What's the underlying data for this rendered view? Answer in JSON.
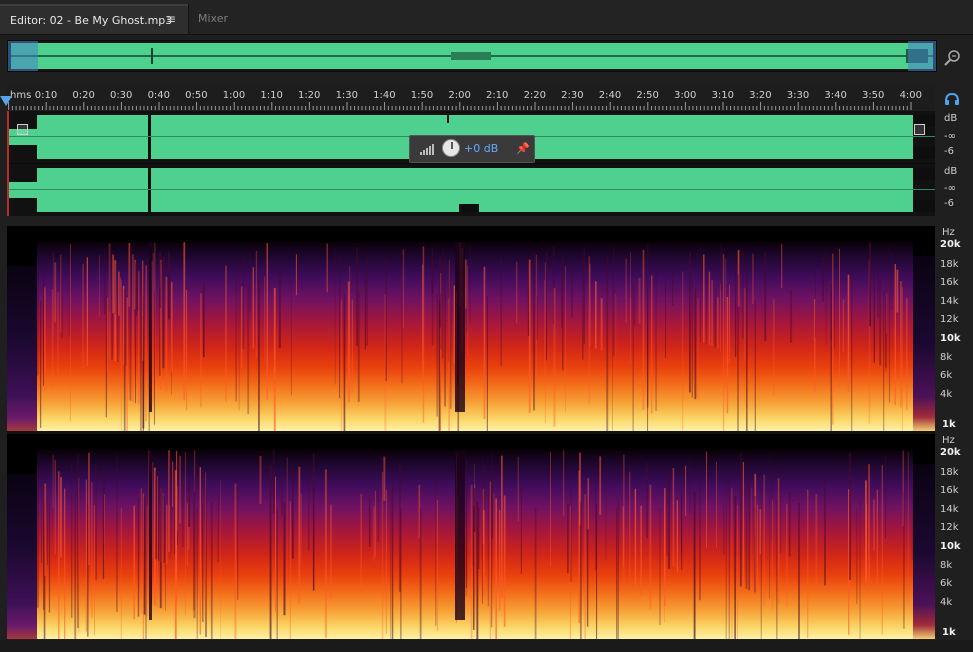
{
  "tabs": {
    "editor_label": "Editor: 02 - Be My Ghost.mp3",
    "mixer_label": "Mixer"
  },
  "ruler": {
    "unit": "hms",
    "ticks": [
      "0:10",
      "0:20",
      "0:30",
      "0:40",
      "0:50",
      "1:00",
      "1:10",
      "1:20",
      "1:30",
      "1:40",
      "1:50",
      "2:00",
      "2:10",
      "2:20",
      "2:30",
      "2:40",
      "2:50",
      "3:00",
      "3:10",
      "3:20",
      "3:30",
      "3:40",
      "3:50",
      "4:00"
    ]
  },
  "hud": {
    "value": "+0 dB"
  },
  "db_scale": {
    "unit": "dB",
    "labels": [
      "-∞",
      "-6"
    ]
  },
  "hz_scale": {
    "unit": "Hz",
    "labels": [
      "20k",
      "18k",
      "16k",
      "14k",
      "12k",
      "10k",
      "8k",
      "6k",
      "4k",
      "1k"
    ]
  },
  "icons": {
    "tab_menu": "hamburger-icon",
    "zoom": "zoom-icon",
    "headphone": "headphone-icon",
    "meter": "level-meter-icon",
    "pin": "pin-icon"
  },
  "colors": {
    "waveform": "#4ed18f",
    "accent": "#5aa3e8",
    "hud_value": "#66a8ff"
  }
}
